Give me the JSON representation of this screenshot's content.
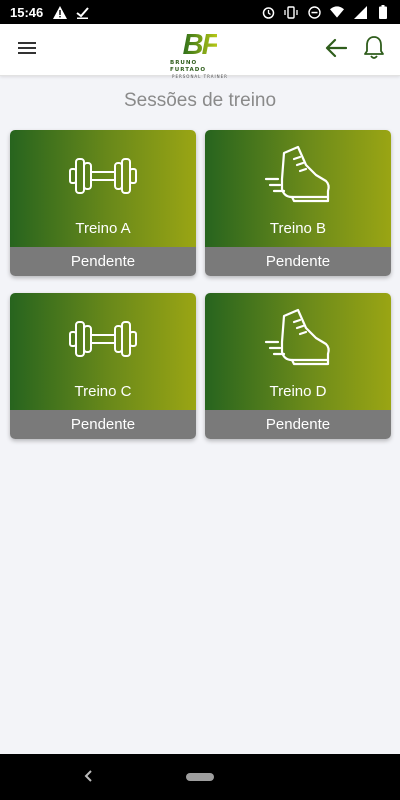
{
  "status_bar": {
    "time": "15:46",
    "left_icons": [
      "alert-icon",
      "check-icon"
    ],
    "right_icons": [
      "alarm-icon",
      "vibrate-icon",
      "dnd-icon",
      "wifi-icon",
      "signal-icon",
      "battery-icon"
    ]
  },
  "header": {
    "menu_icon": "hamburger-menu-icon",
    "logo": {
      "mark": "BF",
      "name": "BRUNO FURTADO",
      "subtitle": "PERSONAL TRAINER"
    },
    "back_icon": "arrow-left-icon",
    "notification_icon": "bell-icon"
  },
  "page": {
    "title": "Sessões de treino"
  },
  "sessions": [
    {
      "title": "Treino A",
      "status": "Pendente",
      "icon": "dumbbell-icon"
    },
    {
      "title": "Treino B",
      "status": "Pendente",
      "icon": "running-shoe-icon"
    },
    {
      "title": "Treino C",
      "status": "Pendente",
      "icon": "dumbbell-icon"
    },
    {
      "title": "Treino D",
      "status": "Pendente",
      "icon": "running-shoe-icon"
    }
  ],
  "colors": {
    "card_gradient_start": "#27641e",
    "card_gradient_end": "#9aa514",
    "status_bar_bg": "#7a7a7a",
    "accent_green": "#2f5d1c"
  }
}
